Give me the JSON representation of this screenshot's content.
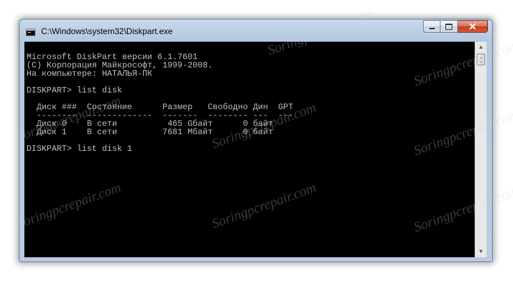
{
  "window": {
    "title": "C:\\Windows\\system32\\Diskpart.exe",
    "icon": "console-app-icon",
    "buttons": {
      "minimize": "minimize",
      "maximize": "maximize",
      "close": "close"
    }
  },
  "console": {
    "lines": [
      "Microsoft DiskPart версии 6.1.7601",
      "(C) Корпорация Майкрософт, 1999-2008.",
      "На компьютере: НАТАЛЬЯ-ПК",
      "",
      "DISKPART> list disk",
      "",
      "  Диск ###  Состояние      Размер   Свободно Дин  GPT",
      "  --------  -------------  -------  -------- ---  ---",
      "  Диск 0    В сети          465 Gбайт      0 байт",
      "  Диск 1    В сети         7681 Mбайт      0 байт",
      "",
      "DISKPART> list disk 1"
    ],
    "background": "#000000",
    "foreground": "#c0c0c0"
  },
  "watermark": "Soringpcrepair.com",
  "colors": {
    "frame": "#b8cbe2",
    "close_button": "#c6391a"
  }
}
